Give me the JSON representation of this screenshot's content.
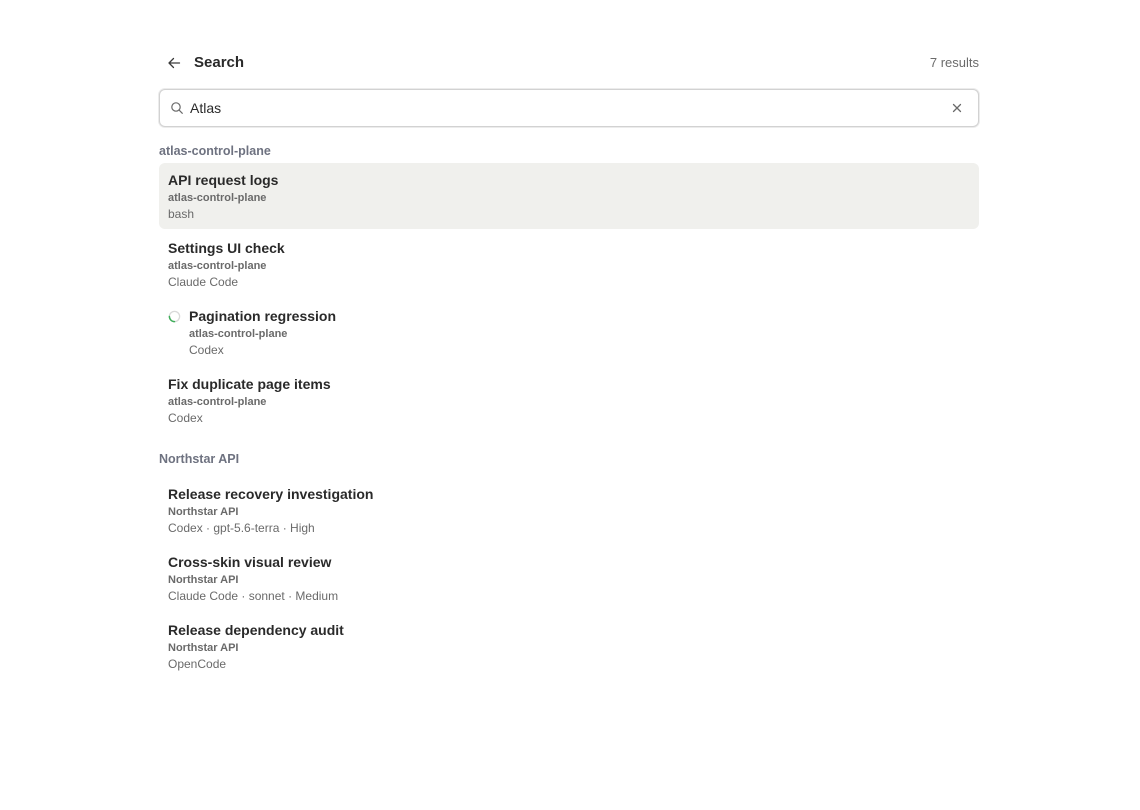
{
  "header": {
    "title": "Search",
    "result_count": "7 results"
  },
  "search": {
    "value": "Atlas",
    "placeholder": ""
  },
  "groups": [
    {
      "title": "atlas-control-plane",
      "items": [
        {
          "title": "API request logs",
          "project": "atlas-control-plane",
          "meta": "bash",
          "selected": true
        },
        {
          "title": "Settings UI check",
          "project": "atlas-control-plane",
          "meta": "Claude Code"
        },
        {
          "title": "Pagination regression",
          "project": "atlas-control-plane",
          "meta": "Codex",
          "status": "running"
        },
        {
          "title": "Fix duplicate page items",
          "project": "atlas-control-plane",
          "meta": "Codex"
        }
      ]
    },
    {
      "title": "Northstar API",
      "items": [
        {
          "title": "Release recovery investigation",
          "project": "Northstar API",
          "meta": "Codex · gpt-5.6-terra · High"
        },
        {
          "title": "Cross-skin visual review",
          "project": "Northstar API",
          "meta": "Claude Code · sonnet · Medium"
        },
        {
          "title": "Release dependency audit",
          "project": "Northstar API",
          "meta": "OpenCode"
        }
      ]
    }
  ],
  "icons": {
    "back": "arrow-left-icon",
    "search": "search-icon",
    "clear": "close-icon",
    "spinner": "loading-spinner-icon"
  },
  "colors": {
    "selected_bg": "#f0f0ed",
    "spinner": "#3fae5a"
  }
}
